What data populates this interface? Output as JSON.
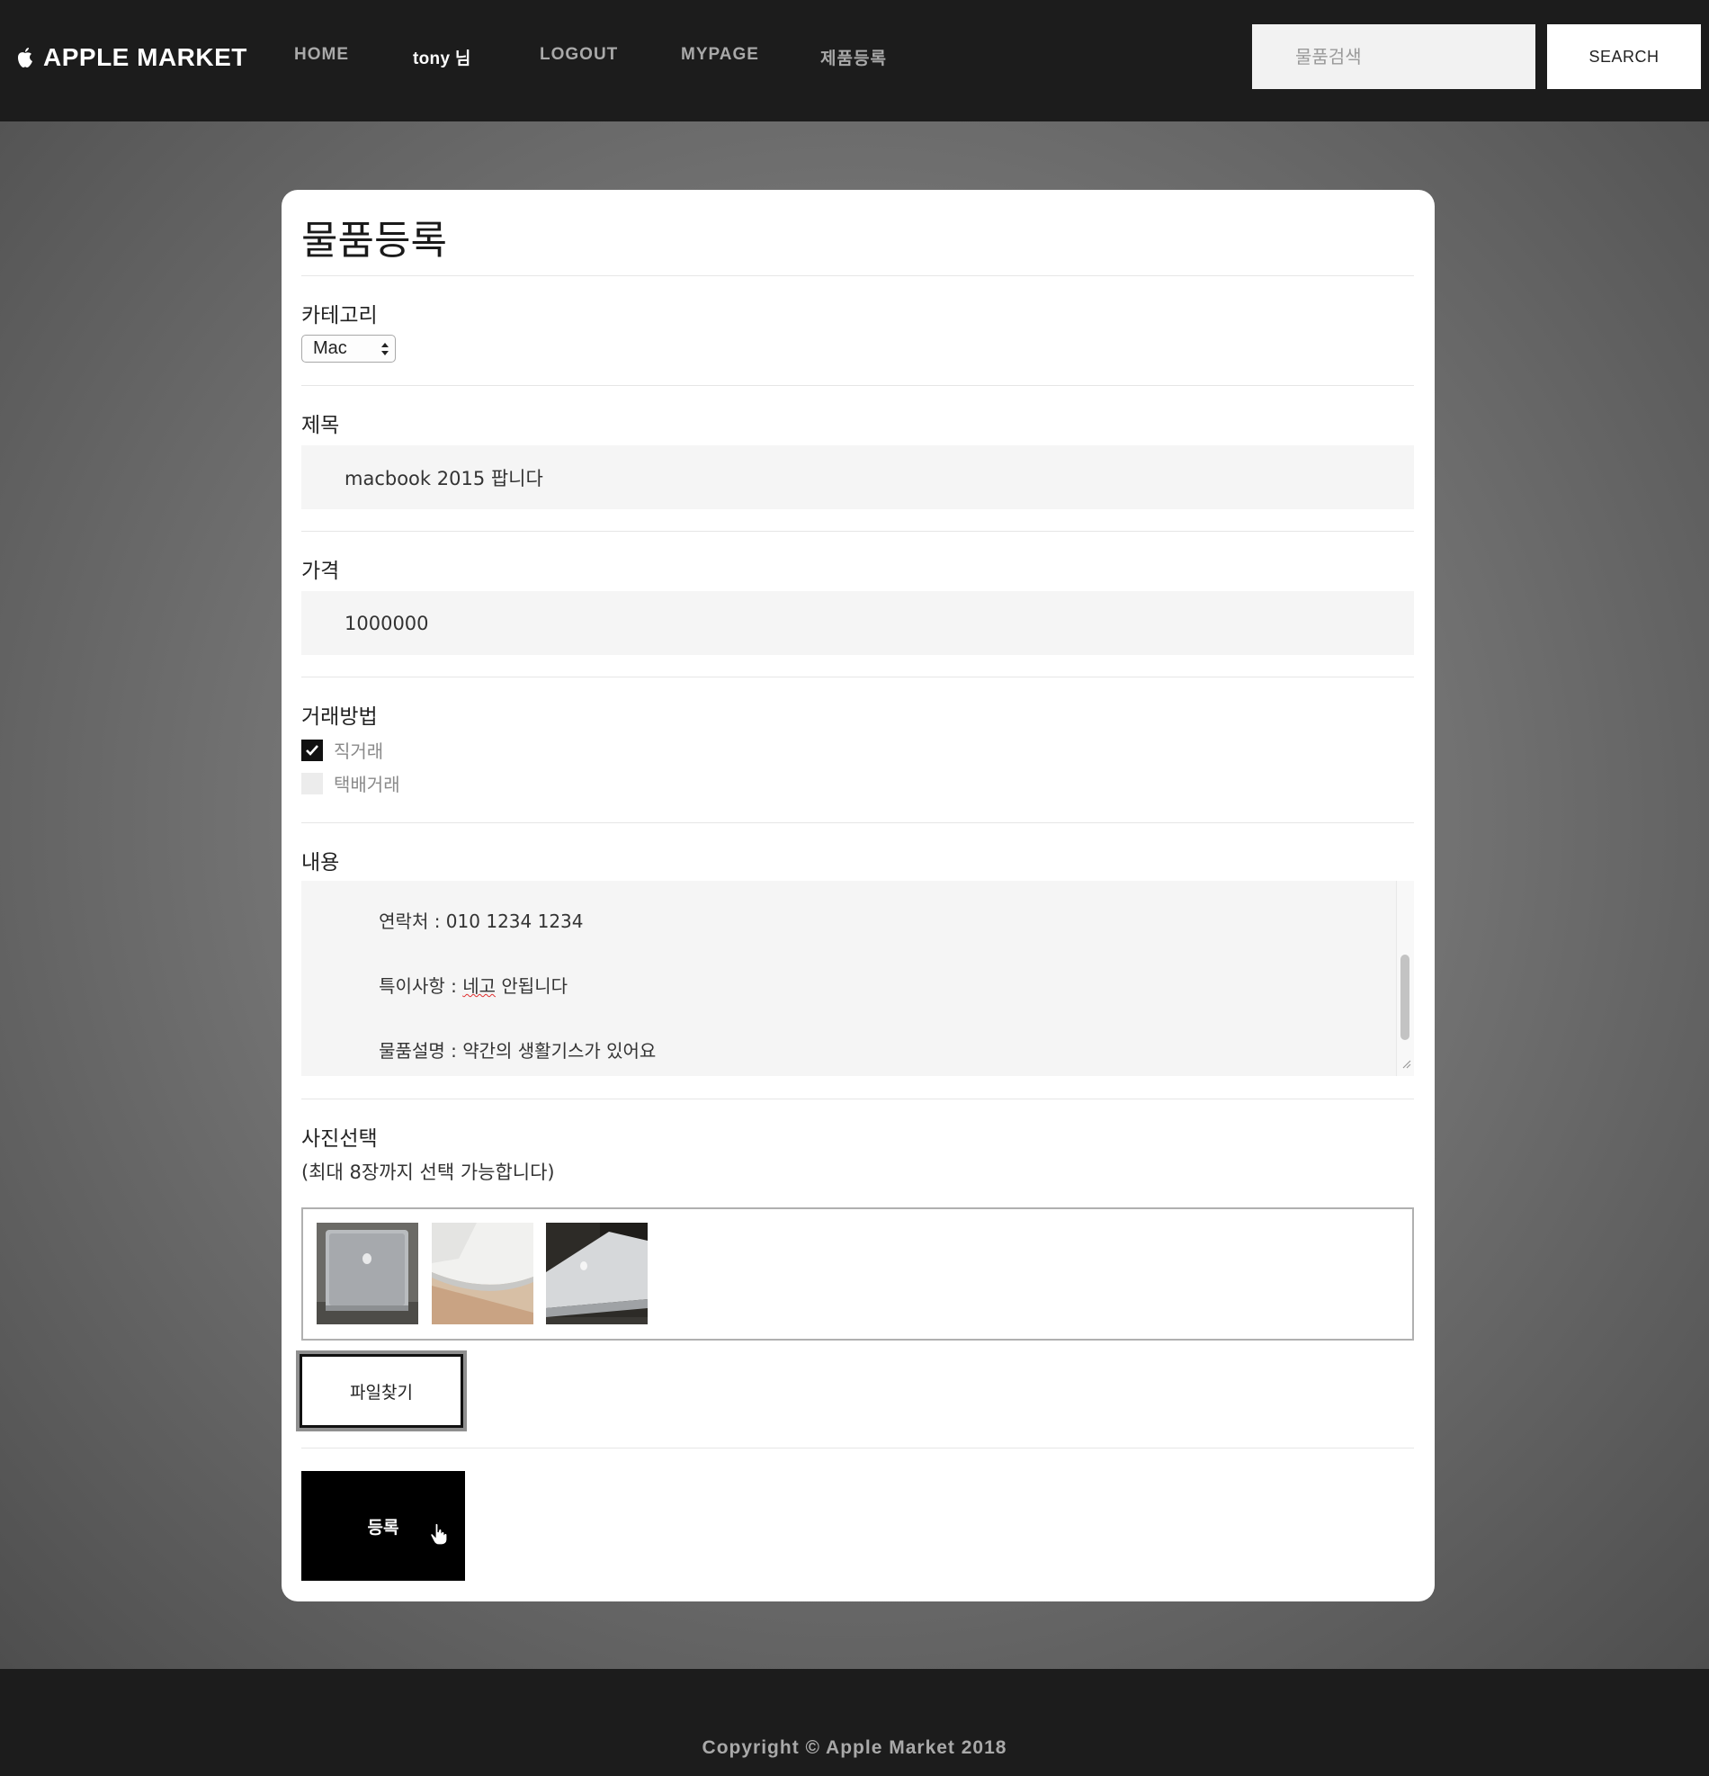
{
  "nav": {
    "brand": "APPLE MARKET",
    "home": "HOME",
    "user": "tony 님",
    "logout": "LOGOUT",
    "mypage": "MYPAGE",
    "register": "제품등록",
    "search_placeholder": "물품검색",
    "search_button": "SEARCH"
  },
  "form": {
    "title": "물품등록",
    "category_label": "카테고리",
    "category_value": "Mac",
    "title_label": "제목",
    "title_value": "macbook 2015 팝니다",
    "price_label": "가격",
    "price_value": "1000000",
    "trade_label": "거래방법",
    "trade_options": [
      {
        "label": "직거래",
        "checked": true
      },
      {
        "label": "택배거래",
        "checked": false
      }
    ],
    "content_label": "내용",
    "content_lines": [
      {
        "prefix": "연락처 : 010 1234 1234",
        "flagged": "",
        "suffix": ""
      },
      {
        "prefix": "특이사항 : ",
        "flagged": "네고",
        "suffix": " 안됩니다"
      },
      {
        "prefix": "물품설명 : 약간의 생활기스가 있어요",
        "flagged": "",
        "suffix": ""
      }
    ],
    "photo_label": "사진선택",
    "photo_hint": "(최대 8장까지 선택 가능합니다)",
    "photos": [
      "macbook-top-view",
      "macbook-edge-on-wood",
      "macbook-side-open"
    ],
    "file_button": "파일찾기",
    "submit_button": "등록"
  },
  "footer": {
    "copyright": "Copyright © Apple Market 2018"
  }
}
